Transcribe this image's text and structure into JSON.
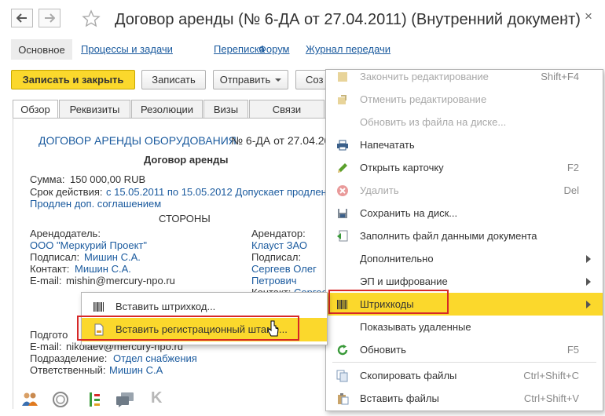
{
  "window": {
    "title": "Договор аренды (№ 6-ДА от 27.04.2011) (Внутренний документ)",
    "close_glyph": "×"
  },
  "nav_links": {
    "main": "Основное",
    "processes": "Процессы и задачи",
    "correspondence": "Переписка",
    "forum": "Форум",
    "transfer_log": "Журнал передачи"
  },
  "toolbar": {
    "write_close": "Записать и закрыть",
    "write": "Записать",
    "send": "Отправить",
    "create_partial": "Соз"
  },
  "tabs": [
    "Обзор",
    "Реквизиты",
    "Резолюции",
    "Визы",
    "Связи"
  ],
  "document": {
    "header_link": "ДОГОВОР АРЕНДЫ ОБОРУДОВАНИЯ",
    "header_rest": "№ 6-ДА от 27.04.20",
    "heading": "Договор аренды",
    "sum_label": "Сумма:",
    "sum_value": "150 000,00 RUB",
    "term_label": "Срок действия:",
    "term_value": "с 15.05.2011 по 15.05.2012 Допускает продлен",
    "extension": "Продлен доп. соглашением",
    "parties_heading": "СТОРОНЫ",
    "lessor": {
      "label": "Арендодатель:",
      "name": "ООО \"Меркурий Проект\"",
      "signed_label": "Подписал:",
      "signed_value": "Мишин С.А.",
      "contact_label": "Контакт:",
      "contact_value": "Мишин С.А.",
      "email_label": "E-mail:",
      "email_value": "mishin@mercury-npo.ru"
    },
    "lessee": {
      "label": "Арендатор:",
      "name": "Клауст ЗАО",
      "signed_label": "Подписал:",
      "signed_value_1": "Сергеев Олег",
      "signed_value_2": "Петрович",
      "contact_label": "Контакт:",
      "contact_value": "Сергее"
    },
    "prepared_label": "Подгото",
    "prep_email_label": "E-mail:",
    "prep_email_value": "nikolaev@mercury-npo.ru",
    "division_label": "Подразделение:",
    "division_value": "Отдел снабжения",
    "responsible_label": "Ответственный:",
    "responsible_value": "Мишин С.А"
  },
  "context_menu": {
    "items": [
      {
        "label": "Закончить редактирование",
        "shortcut": "Shift+F4",
        "disabled": true
      },
      {
        "label": "Отменить редактирование",
        "shortcut": "",
        "disabled": true
      },
      {
        "label": "Обновить из файла на диске...",
        "shortcut": "",
        "disabled": true
      },
      {
        "label": "Напечатать",
        "shortcut": ""
      },
      {
        "label": "Открыть карточку",
        "shortcut": "F2"
      },
      {
        "label": "Удалить",
        "shortcut": "Del",
        "disabled": true
      },
      {
        "label": "Сохранить на диск...",
        "shortcut": ""
      },
      {
        "label": "Заполнить файл данными документа",
        "shortcut": ""
      },
      {
        "label": "Дополнительно",
        "shortcut": ""
      },
      {
        "label": "ЭП и шифрование",
        "shortcut": ""
      },
      {
        "label": "Штрихкоды",
        "shortcut": ""
      },
      {
        "label": "Показывать удаленные",
        "shortcut": ""
      },
      {
        "label": "Обновить",
        "shortcut": "F5"
      },
      {
        "label": "Скопировать файлы",
        "shortcut": "Ctrl+Shift+C"
      },
      {
        "label": "Вставить файлы",
        "shortcut": "Ctrl+Shift+V"
      }
    ]
  },
  "barcode_submenu": {
    "items": [
      {
        "label": "Вставить штрихкод..."
      },
      {
        "label": "Вставить регистрационный штамп..."
      }
    ]
  },
  "colors": {
    "accent_yellow": "#fbd82c",
    "link_blue": "#1a5a9e",
    "highlight_red": "#d62828"
  }
}
